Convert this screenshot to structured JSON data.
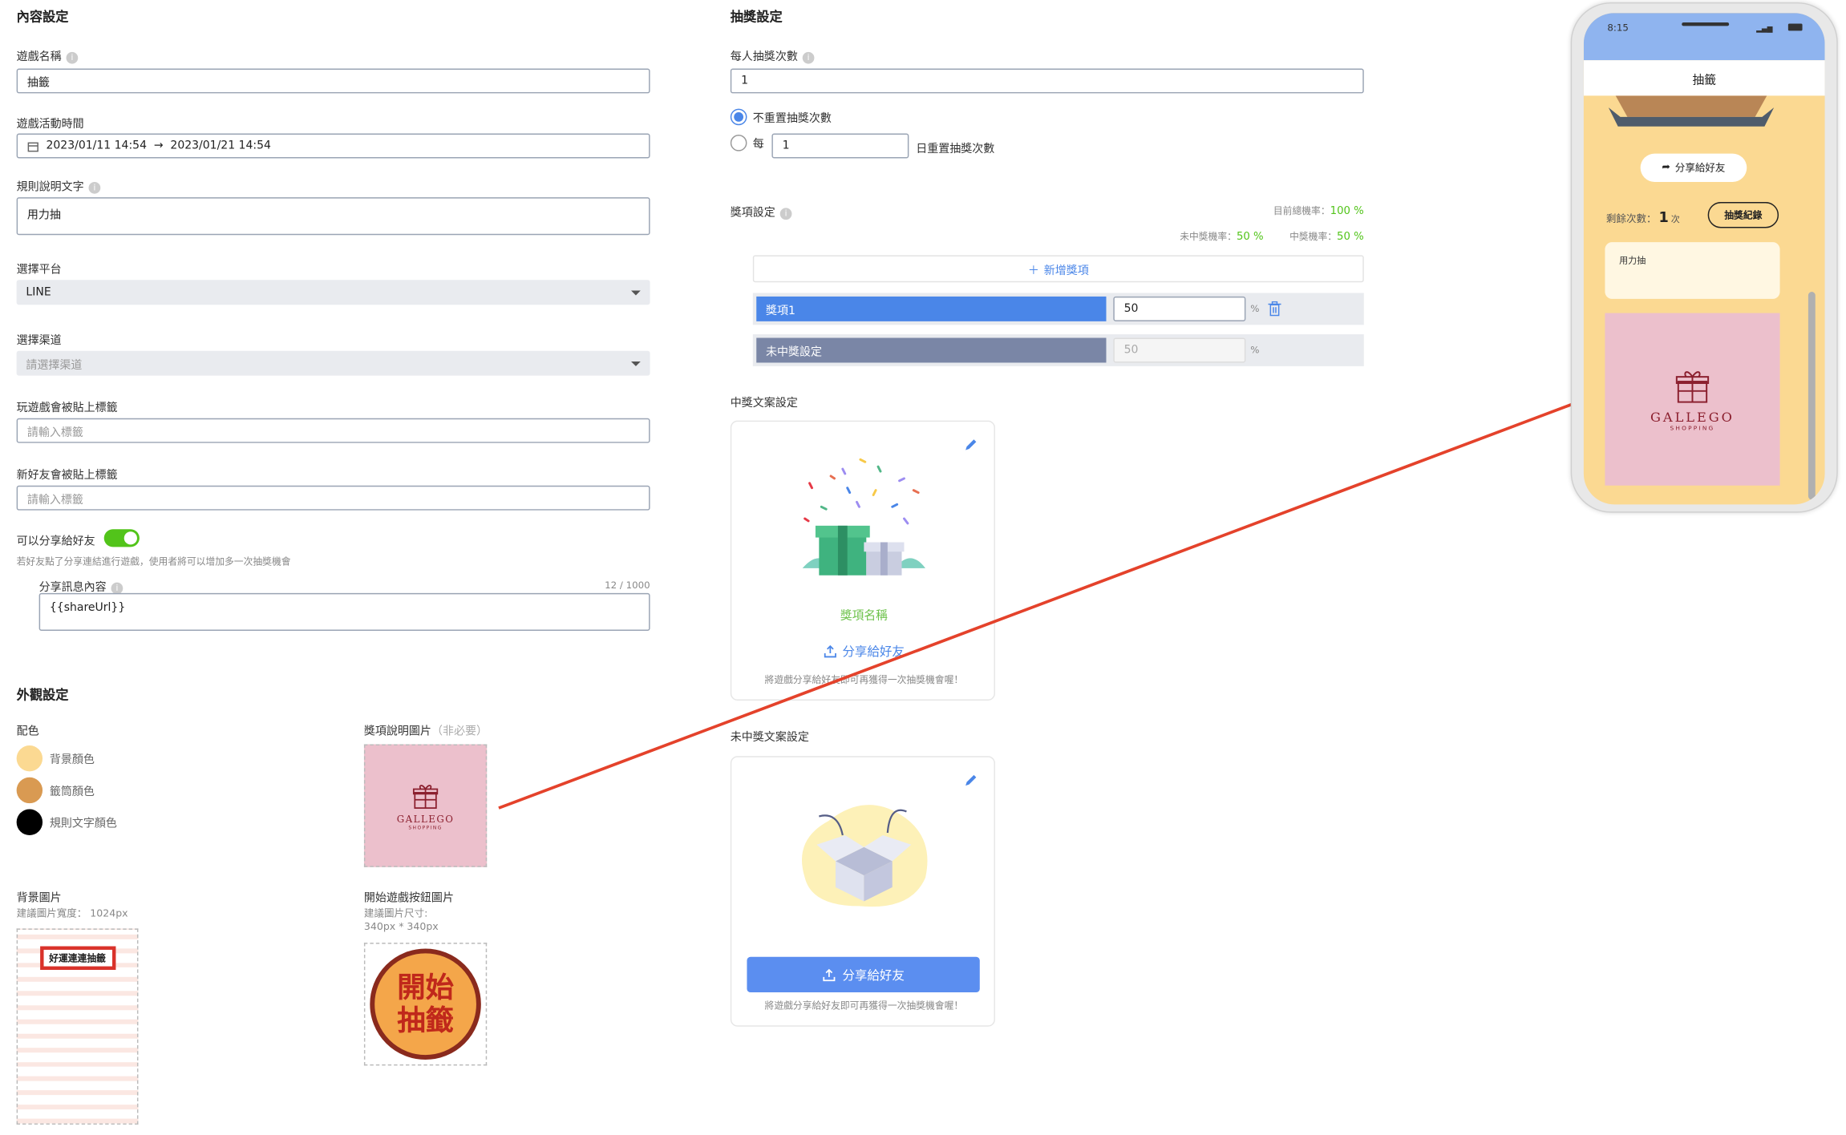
{
  "content_settings": {
    "title": "內容設定",
    "game_name_label": "遊戲名稱",
    "game_name_value": "抽籤",
    "period_label": "遊戲活動時間",
    "period_start": "2023/01/11 14:54",
    "period_arrow": "→",
    "period_end": "2023/01/21 14:54",
    "rule_label": "規則說明文字",
    "rule_value": "用力抽",
    "platform_label": "選擇平台",
    "platform_value": "LINE",
    "channel_label": "選擇渠道",
    "channel_placeholder": "請選擇渠道",
    "play_tag_label": "玩遊戲會被貼上標籤",
    "play_tag_placeholder": "請輸入標籤",
    "friend_tag_label": "新好友會被貼上標籤",
    "friend_tag_placeholder": "請輸入標籤",
    "share_label": "可以分享給好友",
    "share_enabled": true,
    "share_hint": "若好友點了分享連結進行遊戲，使用者將可以增加多一次抽獎機會",
    "share_msg_label": "分享訊息內容",
    "share_msg_count": "12 / 1000",
    "share_msg_value": "{{shareUrl}}"
  },
  "appearance": {
    "title": "外觀設定",
    "colors_label": "配色",
    "colors": [
      {
        "name": "背景顏色",
        "hex": "#fbd992"
      },
      {
        "name": "籤筒顏色",
        "hex": "#d99a52"
      },
      {
        "name": "規則文字顏色",
        "hex": "#000000"
      }
    ],
    "prize_img_label": "獎項說明圖片",
    "prize_img_optional": "（非必要）",
    "bg_img_label": "背景圖片",
    "bg_img_hint": "建議圖片寬度： 1024px",
    "bg_banner_text": "好運連連抽籤",
    "start_btn_label": "開始遊戲按鈕圖片",
    "start_btn_hint1": "建議圖片尺寸:",
    "start_btn_hint2": "340px * 340px",
    "start_btn_text1": "開始",
    "start_btn_text2": "抽籤",
    "gallego_brand": "GALLEGO",
    "gallego_sub": "SHOPPING"
  },
  "lottery": {
    "title": "抽獎設定",
    "per_person_label": "每人抽獎次數",
    "per_person_value": "1",
    "radio_no_reset": "不重置抽獎次數",
    "radio_each_prefix": "每",
    "radio_each_value": "1",
    "radio_each_suffix": "日重置抽獎次數",
    "prize_settings_label": "獎項設定",
    "total_prob_label": "目前總機率：",
    "total_prob_value": "100 %",
    "lose_prob_label": "未中獎機率：",
    "lose_prob_value": "50 %",
    "win_prob_label": "中獎機率：",
    "win_prob_value": "50 %",
    "add_prize": "新增獎項",
    "prizes": [
      {
        "name": "獎項1",
        "value": "50",
        "unit": "%"
      },
      {
        "name": "未中獎設定",
        "value": "50",
        "unit": "%"
      }
    ]
  },
  "win_copy": {
    "title": "中獎文案設定",
    "prize_name": "獎項名稱",
    "share": "分享給好友",
    "hint": "將遊戲分享給好友即可再獲得一次抽獎機會喔！"
  },
  "lose_copy": {
    "title": "未中獎文案設定",
    "share": "分享給好友",
    "hint": "將遊戲分享給好友即可再獲得一次抽獎機會喔！"
  },
  "phone": {
    "time": "8:15",
    "page_title": "抽籤",
    "share_btn": "分享給好友",
    "remaining_label": "剩餘次數：",
    "remaining_value": "1",
    "remaining_unit": "次",
    "record_btn": "抽獎紀錄",
    "rule_text": "用力抽"
  },
  "colors": {
    "primary": "#5b8ef0",
    "green": "#52c41a",
    "arrow": "#e4422b",
    "phone_bg": "#fbd992"
  }
}
